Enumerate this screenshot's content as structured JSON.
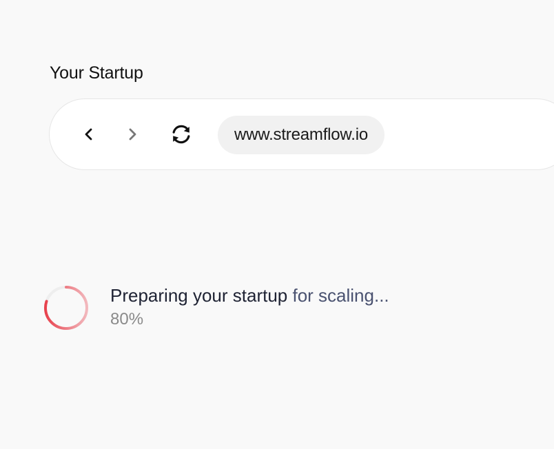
{
  "header": {
    "title": "Your Startup"
  },
  "browser": {
    "back_icon": "chevron-left-icon",
    "forward_icon": "chevron-right-icon",
    "reload_icon": "refresh-icon",
    "url": "www.streamflow.io"
  },
  "status": {
    "message_part1": "Preparing your startup",
    "message_part2": " for scaling...",
    "percent_label": "80%",
    "progress": 0.8,
    "accent_color": "#e8424d"
  }
}
